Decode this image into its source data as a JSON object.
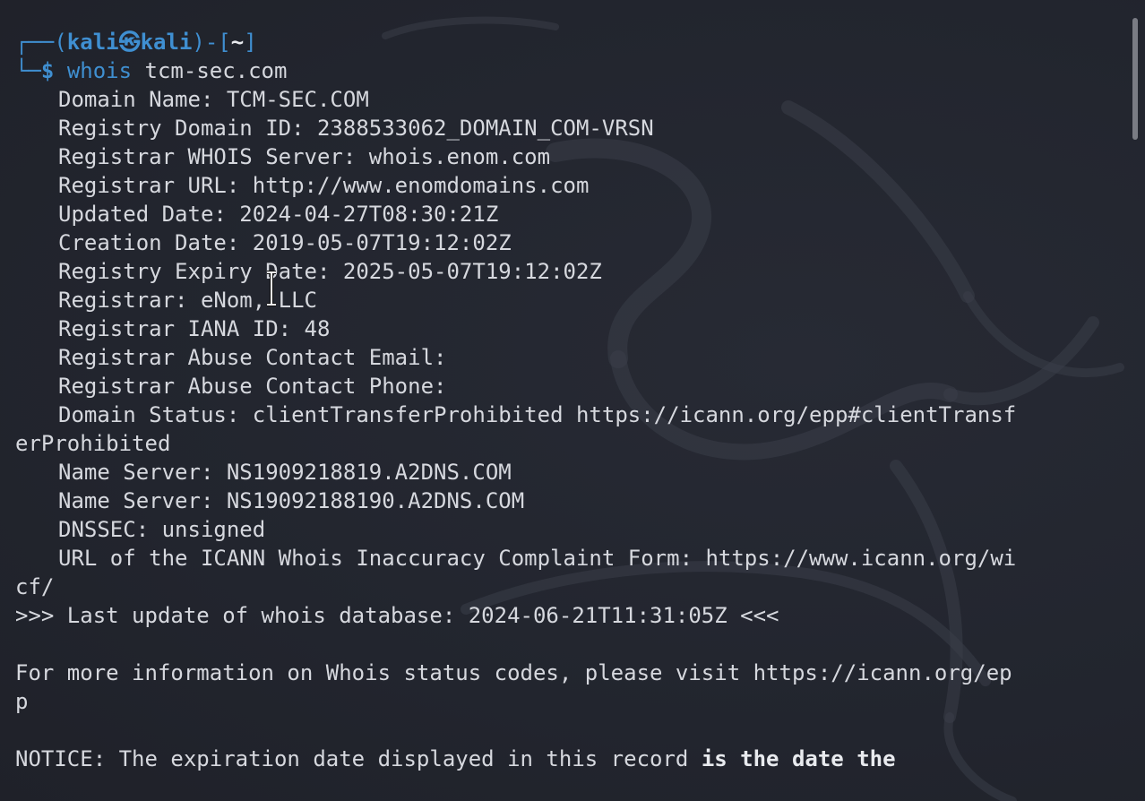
{
  "prompt": {
    "user": "kali",
    "separator": "㉿",
    "host": "kali",
    "dir": "~",
    "command": "whois",
    "argument": "tcm-sec.com"
  },
  "output": {
    "domain_name": "Domain Name: TCM-SEC.COM",
    "registry_domain_id": "Registry Domain ID: 2388533062_DOMAIN_COM-VRSN",
    "registrar_whois_server": "Registrar WHOIS Server: whois.enom.com",
    "registrar_url": "Registrar URL: http://www.enomdomains.com",
    "updated_date": "Updated Date: 2024-04-27T08:30:21Z",
    "creation_date": "Creation Date: 2019-05-07T19:12:02Z",
    "registry_expiry_date": "Registry Expiry Date: 2025-05-07T19:12:02Z",
    "registrar": "Registrar: eNom, LLC",
    "registrar_iana_id": "Registrar IANA ID: 48",
    "abuse_email": "Registrar Abuse Contact Email:",
    "abuse_phone": "Registrar Abuse Contact Phone:",
    "domain_status_1": "Domain Status: clientTransferProhibited https://icann.org/epp#clientTransf",
    "domain_status_2": "erProhibited",
    "name_server_1": "Name Server: NS1909218819.A2DNS.COM",
    "name_server_2": "Name Server: NS19092188190.A2DNS.COM",
    "dnssec": "DNSSEC: unsigned",
    "icann_url_1": "URL of the ICANN Whois Inaccuracy Complaint Form: https://www.icann.org/wi",
    "icann_url_2": "cf/",
    "last_update": ">>> Last update of whois database: 2024-06-21T11:31:05Z <<<",
    "info_1": "For more information on Whois status codes, please visit https://icann.org/ep",
    "info_2": "p",
    "notice_plain": "NOTICE: The expiration date displayed in this record ",
    "notice_bold": "is the date the"
  },
  "colors": {
    "background": "#22252e",
    "prompt_blue": "#3f8fd1",
    "text": "#d6d8de"
  },
  "icons": {
    "watermark": "kali-dragon-icon",
    "cursor": "text-cursor-icon"
  }
}
